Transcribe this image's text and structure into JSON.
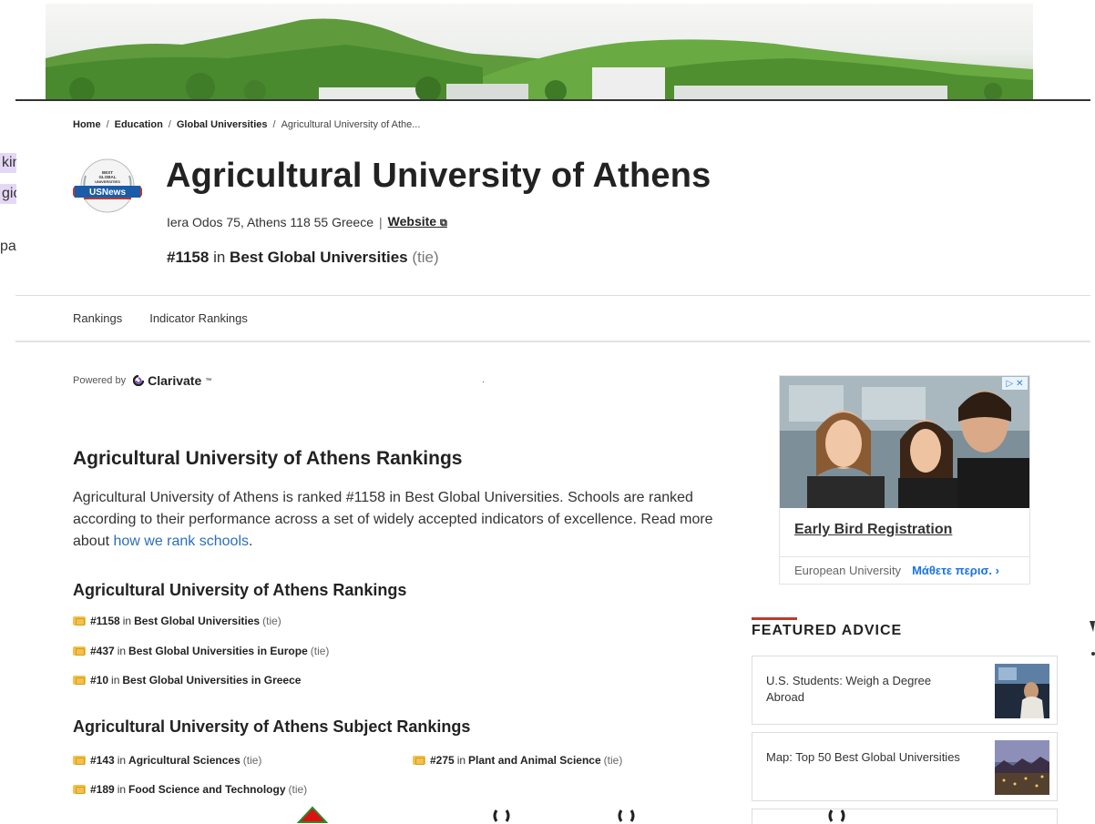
{
  "breadcrumb": {
    "home": "Home",
    "education": "Education",
    "global": "Global Universities",
    "current": "Agricultural University of Athe..."
  },
  "side_clip": {
    "line1": "kin",
    "line2": "gio",
    "line3": "pa"
  },
  "header": {
    "logo_text_top": "BEST GLOBAL UNIVERSITIES",
    "logo_brand": "USNews",
    "title": "Agricultural University of Athens",
    "address": "Iera Odos 75, Athens 118 55 Greece",
    "pipe": "|",
    "website": "Website",
    "rank_num": "#1158",
    "rank_in": "in",
    "rank_list": "Best Global Universities",
    "rank_tie": "(tie)"
  },
  "tabs": [
    "Rankings",
    "Indicator Rankings"
  ],
  "powered": {
    "label": "Powered by",
    "brand": "Clarivate",
    "tm": "™"
  },
  "main": {
    "heading": "Agricultural University of Athens Rankings",
    "para_text": "Agricultural University of Athens is ranked #1158 in Best Global Universities. Schools are ranked according to their performance across a set of widely accepted indicators of excellence. Read more about ",
    "para_link": "how we rank schools",
    "para_end": ".",
    "rankings_heading": "Agricultural University of Athens Rankings",
    "rankings": [
      {
        "rank": "#1158",
        "in": "in",
        "list": "Best Global Universities",
        "tie": "(tie)"
      },
      {
        "rank": "#437",
        "in": "in",
        "list": "Best Global Universities in Europe",
        "tie": "(tie)"
      },
      {
        "rank": "#10",
        "in": "in",
        "list": "Best Global Universities in Greece",
        "tie": ""
      }
    ],
    "subject_heading": "Agricultural University of Athens Subject Rankings",
    "subjects": [
      {
        "rank": "#143",
        "in": "in",
        "list": "Agricultural Sciences",
        "tie": "(tie)"
      },
      {
        "rank": "#275",
        "in": "in",
        "list": "Plant and Animal Science",
        "tie": "(tie)"
      },
      {
        "rank": "#189",
        "in": "in",
        "list": "Food Science and Technology",
        "tie": "(tie)"
      }
    ]
  },
  "ad": {
    "title": "Early Bird Registration",
    "advertiser": "European University",
    "cta": "Μάθετε περισ.",
    "cta_arrow": "›"
  },
  "featured": {
    "title": "FEATURED ADVICE",
    "cards": [
      {
        "text": "U.S. Students: Weigh a Degree Abroad"
      },
      {
        "text": "Map: Top 50 Best Global Universities"
      }
    ]
  },
  "colors": {
    "accent_red": "#c0392b",
    "link_blue": "#2a6ebb",
    "badge_gold": "#f2c14e",
    "usnews_blue": "#1a5ca8"
  }
}
